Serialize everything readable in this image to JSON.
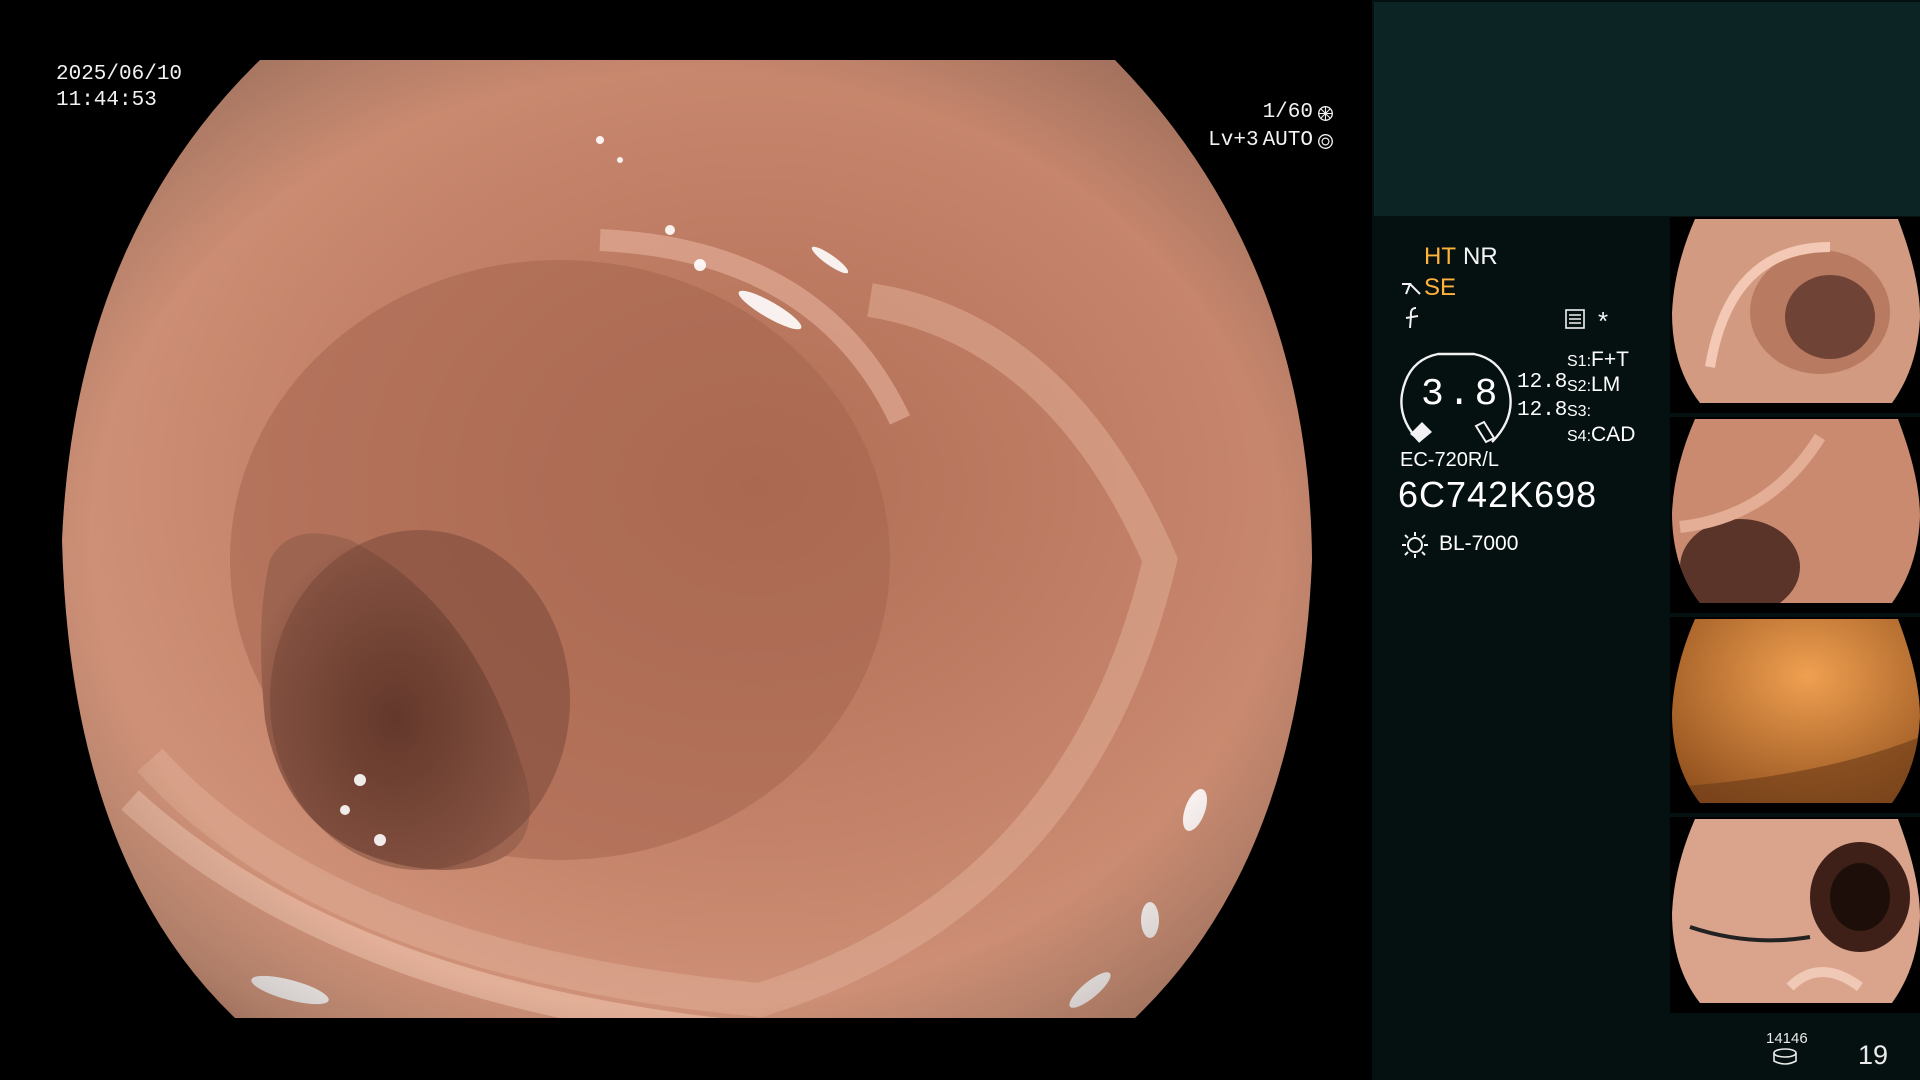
{
  "overlay": {
    "date": "2025/06/10",
    "time": "11:44:53",
    "shutter": "1/60",
    "level": "Lv+3",
    "iris": "AUTO"
  },
  "panel": {
    "ht": "HT",
    "nr": "NR",
    "se": "SE",
    "star": "*",
    "gauge_value": "3.8",
    "readout_1": "12.8",
    "readout_2": "12.8",
    "switches": [
      {
        "key": "S1:",
        "value": "F+T"
      },
      {
        "key": "S2:",
        "value": "LM"
      },
      {
        "key": "S3:",
        "value": ""
      },
      {
        "key": "S4:",
        "value": "CAD"
      }
    ],
    "scope_model": "EC-720R/L",
    "serial": "6C742K698",
    "light_source": "BL-7000"
  },
  "footer": {
    "counter": "14146",
    "page": "19"
  },
  "colors": {
    "accent_orange": "#ffb33c",
    "panel_bg": "#051010",
    "panel_top": "#0c2424",
    "tissue": "#c17a5c"
  }
}
